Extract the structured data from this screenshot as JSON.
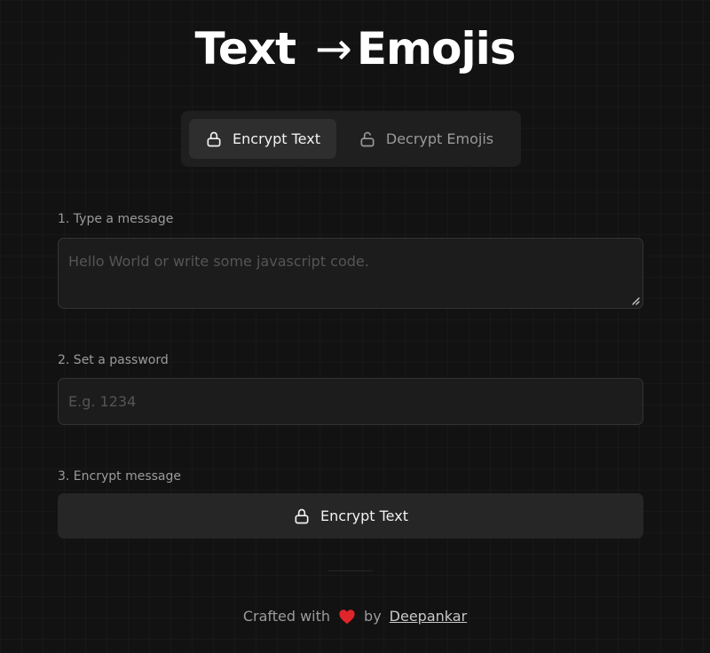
{
  "header": {
    "title_left": "Text",
    "title_arrow": "→",
    "title_right": "Emojis"
  },
  "tabs": [
    {
      "label": "Encrypt Text",
      "icon": "lock-icon",
      "active": true
    },
    {
      "label": "Decrypt Emojis",
      "icon": "unlock-icon",
      "active": false
    }
  ],
  "form": {
    "message": {
      "label": "1. Type a message",
      "placeholder": "Hello World or write some javascript code.",
      "value": ""
    },
    "password": {
      "label": "2. Set a password",
      "placeholder": "E.g. 1234",
      "value": ""
    },
    "encrypt": {
      "label": "3. Encrypt message",
      "button_label": "Encrypt Text",
      "button_icon": "lock-icon"
    }
  },
  "footer": {
    "crafted_text": "Crafted with",
    "heart_icon": "heart-icon",
    "by_text": "by",
    "author": "Deepankar"
  },
  "colors": {
    "background": "#121212",
    "heart": "#e0252b"
  }
}
